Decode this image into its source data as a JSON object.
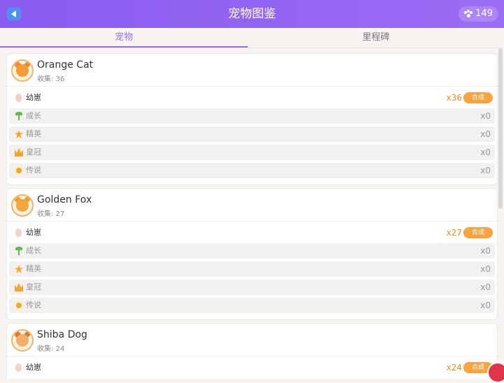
{
  "header": {
    "title": "宠物图鉴",
    "coins": "149"
  },
  "tabs": [
    {
      "label": "宠物",
      "active": true
    },
    {
      "label": "里程碑",
      "active": false
    }
  ],
  "pets": [
    {
      "name": "Orange Cat",
      "collected": "收集: 36",
      "rows": [
        {
          "label": "幼崽",
          "qty": "x36",
          "action": "合成"
        },
        {
          "label": "成长",
          "qty": "x0"
        },
        {
          "label": "精英",
          "qty": "x0"
        },
        {
          "label": "皇冠",
          "qty": "x0"
        },
        {
          "label": "传说",
          "qty": "x0"
        }
      ]
    },
    {
      "name": "Golden Fox",
      "collected": "收集: 27",
      "rows": [
        {
          "label": "幼崽",
          "qty": "x27",
          "action": "合成"
        },
        {
          "label": "成长",
          "qty": "x0"
        },
        {
          "label": "精英",
          "qty": "x0"
        },
        {
          "label": "皇冠",
          "qty": "x0"
        },
        {
          "label": "传说",
          "qty": "x0"
        }
      ]
    },
    {
      "name": "Shiba Dog",
      "collected": "收集: 24",
      "rows": [
        {
          "label": "幼崽",
          "qty": "x24",
          "action": "合成"
        }
      ]
    }
  ],
  "colors": {
    "header": "#8a5cf0",
    "accent": "#9a6cf2",
    "orange": "#f28c1a"
  }
}
